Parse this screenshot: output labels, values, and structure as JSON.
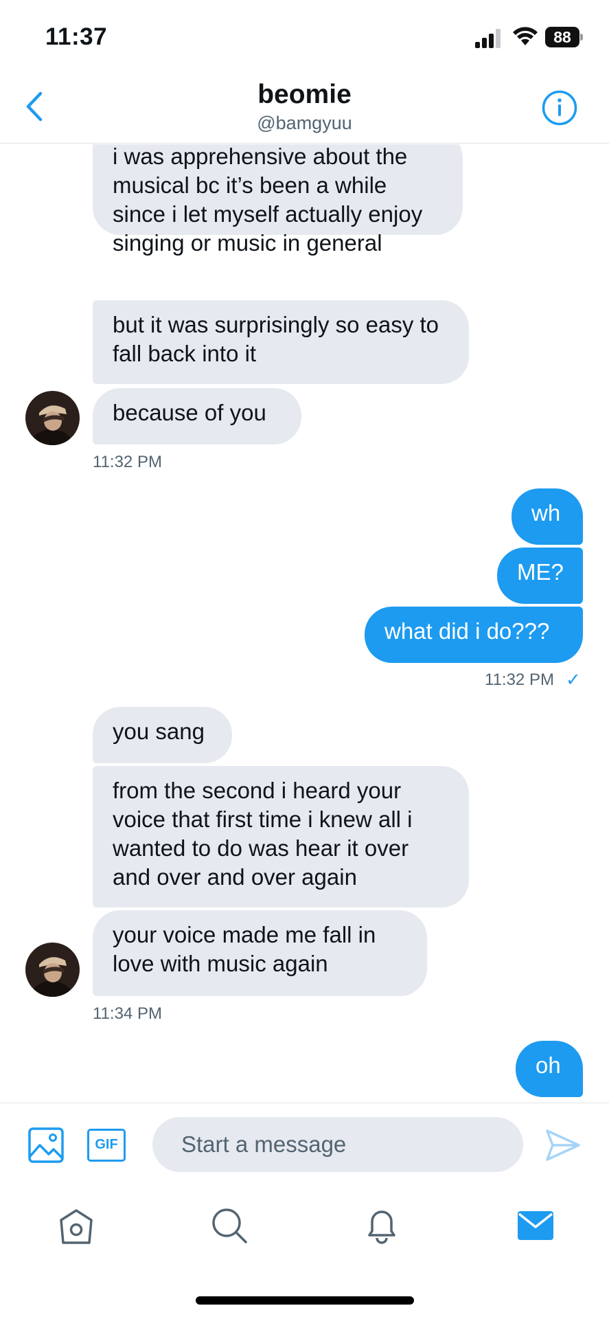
{
  "status_bar": {
    "time": "11:37",
    "battery": "88"
  },
  "header": {
    "name": "beomie",
    "handle": "@bamgyuu"
  },
  "messages": [
    {
      "text": "i was apprehensive about the musical bc it’s been a while since i let myself actually enjoy singing or music in general"
    },
    {
      "text": "but it was surprisingly so easy to fall back into it"
    },
    {
      "text": "because of you"
    },
    {
      "text": "wh"
    },
    {
      "text": "ME?"
    },
    {
      "text": "what did i do???"
    },
    {
      "text": "you sang"
    },
    {
      "text": "from the second i heard your voice that first time i knew all i wanted to do was hear it over and over and over again"
    },
    {
      "text": "your voice made me fall in love with music again"
    },
    {
      "text": "oh"
    }
  ],
  "timestamps": [
    "11:32 PM",
    "11:32 PM",
    "11:34 PM"
  ],
  "read_mark": "✓",
  "composer": {
    "placeholder": "Start a message",
    "gif_label": "GIF"
  },
  "icons": {
    "back": "chevron-left-icon",
    "info": "info-icon",
    "image": "image-icon",
    "gif": "gif-icon",
    "send": "send-icon",
    "tabs": [
      "home-icon",
      "search-icon",
      "bell-icon",
      "mail-icon"
    ]
  },
  "colors": {
    "accent": "#1d9bf0",
    "incoming_bubble": "#e6e9ef",
    "secondary_text": "#536471"
  }
}
